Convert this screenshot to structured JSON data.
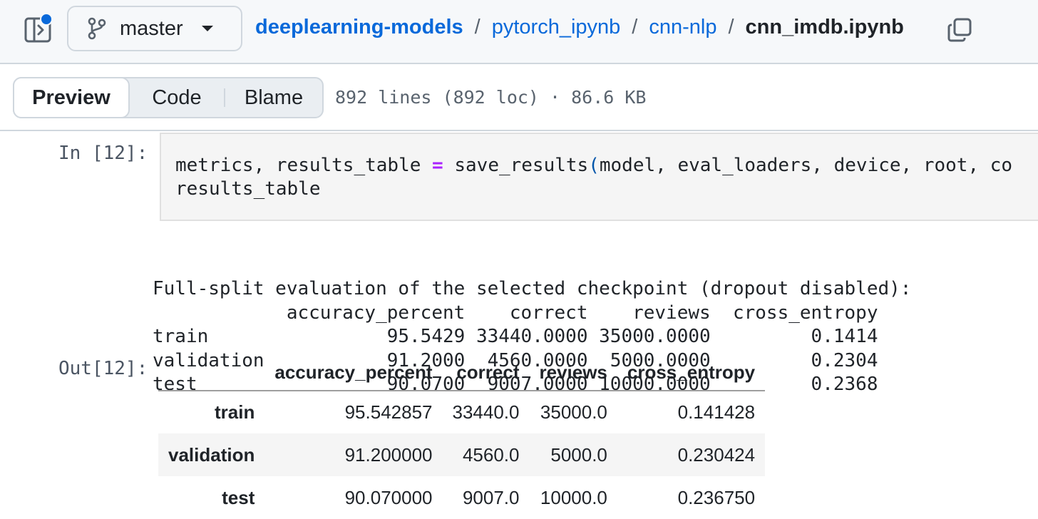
{
  "header": {
    "branch": "master",
    "breadcrumb": {
      "repo": "deeplearning-models",
      "dir1": "pytorch_ipynb",
      "dir2": "cnn-nlp",
      "file": "cnn_imdb.ipynb",
      "separator": "/"
    },
    "icons": {
      "sidebar_toggle": "sidebar-expand-icon",
      "branch": "git-branch-icon",
      "caret": "triangle-down-icon",
      "copy": "copy-icon"
    },
    "colors": {
      "link": "#0969da",
      "notification_dot": "#0969da"
    }
  },
  "toolbar": {
    "tabs": [
      {
        "label": "Preview",
        "active": true
      },
      {
        "label": "Code",
        "active": false
      },
      {
        "label": "Blame",
        "active": false
      }
    ],
    "file_info": "892 lines (892 loc) · 86.6 KB"
  },
  "notebook": {
    "input_prompt": "In [12]:",
    "code": {
      "line1_a": "metrics",
      "line1_b": ",",
      "line1_c": " results_table ",
      "line1_op": "=",
      "line1_d": " save_results",
      "line1_paren": "(",
      "line1_e": "model",
      "line1_f": ",",
      "line1_g": " eval_loaders",
      "line1_h": ",",
      "line1_i": " device",
      "line1_j": ",",
      "line1_k": " root",
      "line1_l": ",",
      "line1_m": " co",
      "line2": "results_table"
    },
    "stream": [
      "Full-split evaluation of the selected checkpoint (dropout disabled):",
      "            accuracy_percent    correct    reviews  cross_entropy",
      "train                95.5429 33440.0000 35000.0000         0.1414",
      "validation           91.2000  4560.0000  5000.0000         0.2304",
      "test                 90.0700  9007.0000 10000.0000         0.2368"
    ],
    "output_prompt": "Out[12]:",
    "table": {
      "columns": [
        "",
        "accuracy_percent",
        "correct",
        "reviews",
        "cross_entropy"
      ],
      "rows": [
        {
          "index": "train",
          "cells": [
            "95.542857",
            "33440.0",
            "35000.0",
            "0.141428"
          ]
        },
        {
          "index": "validation",
          "cells": [
            "91.200000",
            "4560.0",
            "5000.0",
            "0.230424"
          ]
        },
        {
          "index": "test",
          "cells": [
            "90.070000",
            "9007.0",
            "10000.0",
            "0.236750"
          ]
        }
      ]
    }
  }
}
